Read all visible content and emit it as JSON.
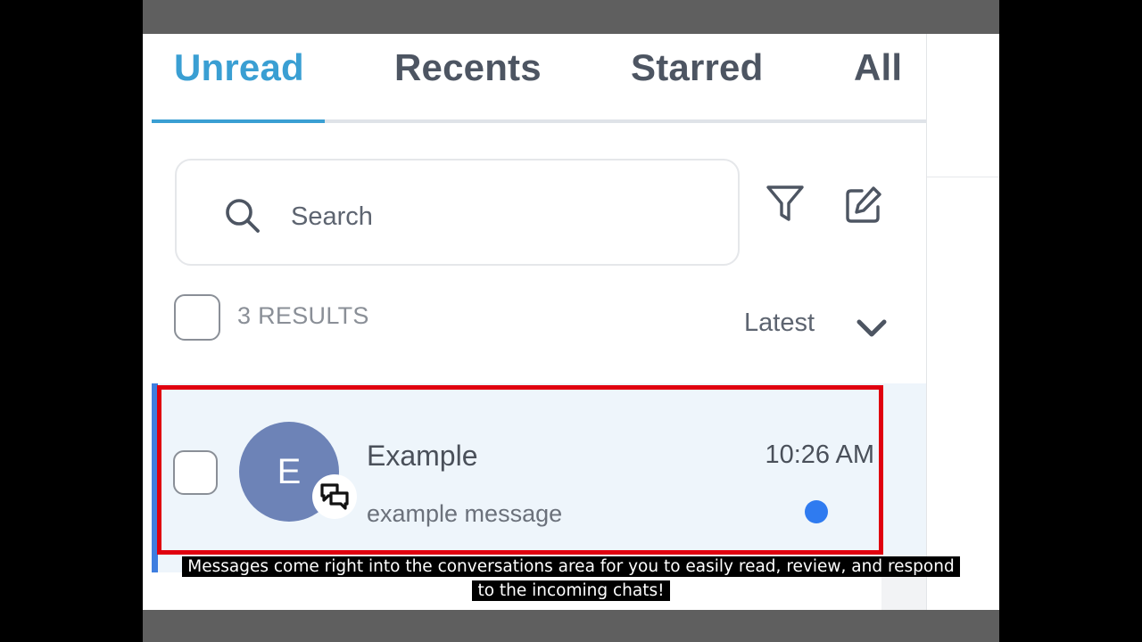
{
  "tabs": [
    {
      "label": "Unread",
      "active": true
    },
    {
      "label": "Recents",
      "active": false
    },
    {
      "label": "Starred",
      "active": false
    },
    {
      "label": "All",
      "active": false
    }
  ],
  "search": {
    "placeholder": "Search"
  },
  "toolbar": {
    "filter_icon": "filter-icon",
    "compose_icon": "compose-icon"
  },
  "results": {
    "count_label": "3 RESULTS",
    "sort_label": "Latest"
  },
  "conversation": {
    "avatar_initial": "E",
    "name": "Example",
    "preview": "example message",
    "time": "10:26 AM",
    "channel_icon": "chat-bubbles-icon",
    "unread": true
  },
  "caption": "Messages come right into the conversations area for you to easily read, review, and respond to the incoming chats!",
  "colors": {
    "accent": "#3a9fd3",
    "unread_dot": "#2f7bf0",
    "avatar": "#6d83b7",
    "highlight": "#e0000f",
    "row_bg": "#eef5fb"
  }
}
